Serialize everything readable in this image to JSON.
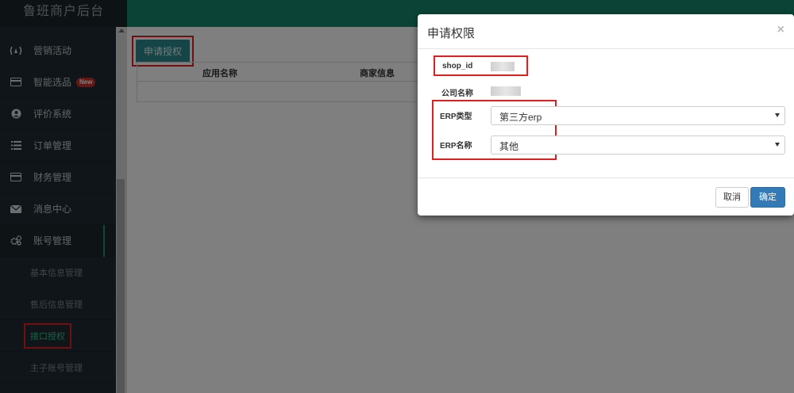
{
  "app": {
    "title": "鲁班商户后台"
  },
  "sidebar": {
    "items": [
      {
        "label": "营销活动",
        "icon": "megaphone-icon"
      },
      {
        "label": "智能选品",
        "icon": "card-icon",
        "badge": "New"
      },
      {
        "label": "评价系统",
        "icon": "user-circle-icon"
      },
      {
        "label": "订单管理",
        "icon": "list-icon"
      },
      {
        "label": "财务管理",
        "icon": "card-icon"
      },
      {
        "label": "消息中心",
        "icon": "envelope-icon"
      },
      {
        "label": "账号管理",
        "icon": "gears-icon"
      }
    ],
    "subitems": [
      {
        "label": "基本信息管理"
      },
      {
        "label": "售后信息管理"
      },
      {
        "label": "接口授权"
      },
      {
        "label": "主子账号管理"
      }
    ]
  },
  "main": {
    "apply_button": "申请授权",
    "table": {
      "columns": [
        "应用名称",
        "商家信息"
      ]
    }
  },
  "modal": {
    "title": "申请权限",
    "close": "×",
    "fields": {
      "shop_id_label": "shop_id",
      "company_label": "公司名称",
      "erp_type_label": "ERP类型",
      "erp_type_value": "第三方erp",
      "erp_name_label": "ERP名称",
      "erp_name_value": "其他"
    },
    "cancel": "取消",
    "confirm": "确定"
  },
  "colors": {
    "header": "#17896c",
    "sidebar": "#1f2a30",
    "primary": "#337ab7",
    "highlight": "#e02020"
  }
}
